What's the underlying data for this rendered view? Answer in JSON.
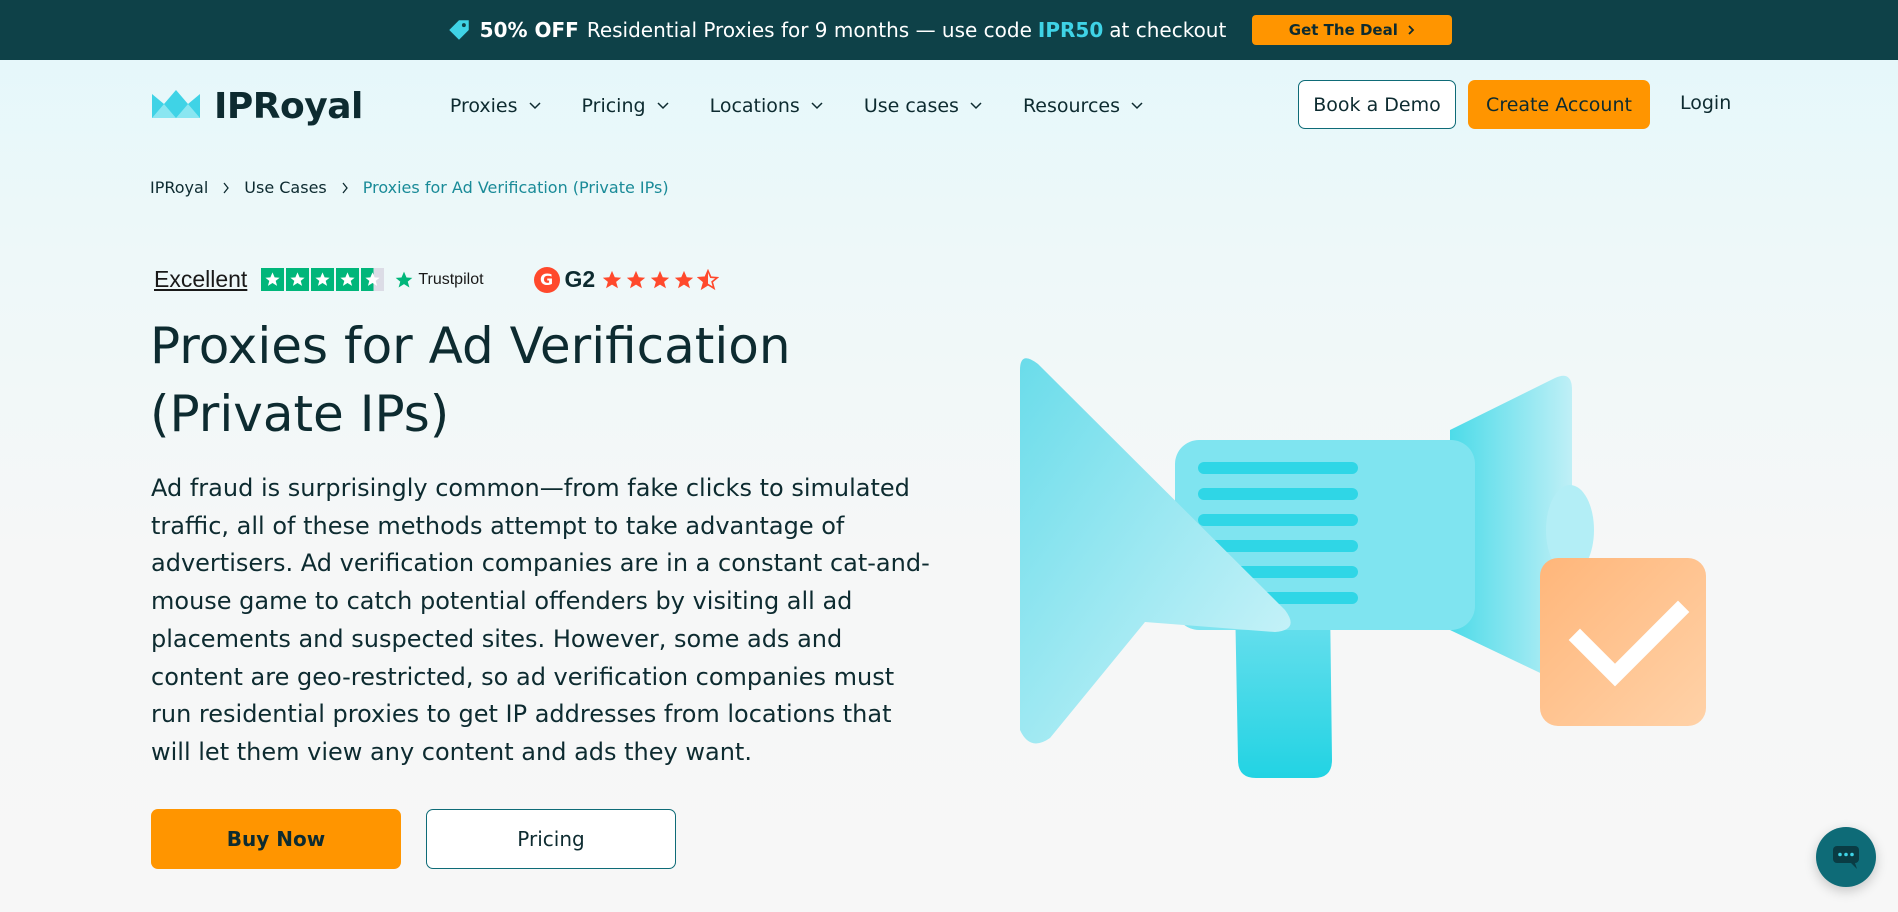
{
  "promo": {
    "percent": "50% OFF",
    "text": "Residential Proxies for 9 months — use code",
    "code": "IPR50",
    "suffix": "at checkout",
    "deal_label": "Get The Deal"
  },
  "header": {
    "logo_text": "IPRoyal",
    "menu": [
      {
        "label": "Proxies"
      },
      {
        "label": "Pricing"
      },
      {
        "label": "Locations"
      },
      {
        "label": "Use cases"
      },
      {
        "label": "Resources"
      }
    ],
    "book_demo_label": "Book a Demo",
    "create_account_label": "Create Account",
    "login_label": "Login"
  },
  "breadcrumb": {
    "items": [
      "IPRoyal",
      "Use Cases"
    ],
    "current": "Proxies for Ad Verification (Private IPs)"
  },
  "ratings": {
    "trustpilot_word": "Excellent",
    "trustpilot_brand": "Trustpilot",
    "trustpilot_stars": 4.5,
    "g2_brand": "G2",
    "g2_stars": 4.5
  },
  "hero": {
    "title_line1": "Proxies for Ad Verification",
    "title_line2": "(Private IPs)",
    "description": "Ad fraud is surprisingly common—from fake clicks to simulated traffic, all of these methods attempt to take advantage of advertisers. Ad verification companies are in a constant cat-and-mouse game to catch potential offenders by visiting all ad placements and suspected sites. However, some ads and content are geo-restricted, so ad verification companies must run residential proxies to get IP addresses from locations that will let them view any content and ads they want.",
    "buy_label": "Buy Now",
    "pricing_label": "Pricing"
  },
  "colors": {
    "accent": "#ff9500",
    "teal_dark": "#0e4148",
    "teal": "#0e6b77",
    "cyan": "#3fd3e6",
    "g2_red": "#ff492c",
    "trustpilot_green": "#00b67a"
  },
  "icons": {
    "promo": "tag-icon",
    "chevron": "chevron-down-icon",
    "chat": "chat-icon",
    "illustration": "megaphone-checkmark-illustration"
  }
}
